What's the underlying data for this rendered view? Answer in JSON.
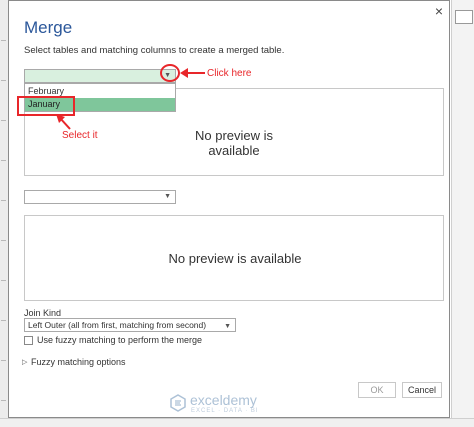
{
  "dialog": {
    "title": "Merge",
    "description": "Select tables and matching columns to create a merged table.",
    "close_glyph": "×"
  },
  "table1": {
    "selected": "",
    "options": [
      "February",
      "January"
    ],
    "highlighted": "January",
    "preview_text": "No preview is available"
  },
  "table2": {
    "selected": "",
    "preview_text": "No preview is available"
  },
  "join": {
    "label": "Join Kind",
    "selected": "Left Outer (all from first, matching from second)"
  },
  "fuzzy": {
    "checkbox_label": "Use fuzzy matching to perform the merge",
    "options_label": "Fuzzy matching options"
  },
  "buttons": {
    "ok": "OK",
    "cancel": "Cancel"
  },
  "annotations": {
    "click_here": "Click here",
    "select_it": "Select it"
  },
  "watermark": {
    "name": "exceldemy",
    "tagline": "EXCEL · DATA · BI"
  },
  "colors": {
    "accent": "#2b579a",
    "annotation": "#e8262a",
    "highlight": "#7fc69b"
  }
}
